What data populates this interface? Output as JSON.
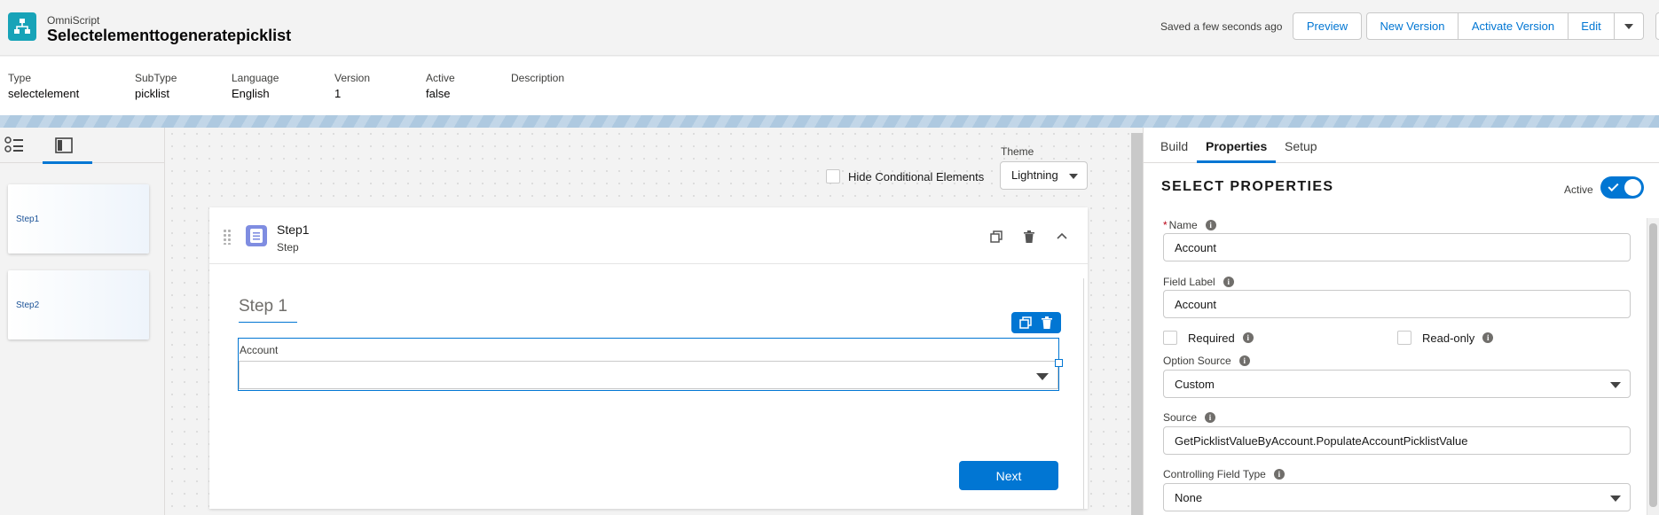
{
  "header": {
    "app_type": "OmniScript",
    "title": "Selectelementtogeneratepicklist",
    "saved_status": "Saved a few seconds ago",
    "buttons": {
      "preview": "Preview",
      "new_version": "New Version",
      "activate_version": "Activate Version",
      "edit": "Edit"
    }
  },
  "meta": [
    {
      "label": "Type",
      "value": "selectelement"
    },
    {
      "label": "SubType",
      "value": "picklist"
    },
    {
      "label": "Language",
      "value": "English"
    },
    {
      "label": "Version",
      "value": "1"
    },
    {
      "label": "Active",
      "value": "false"
    },
    {
      "label": "Description",
      "value": ""
    }
  ],
  "left_panel": {
    "steps": [
      "Step1",
      "Step2"
    ]
  },
  "canvas": {
    "hide_conditional_label": "Hide Conditional Elements",
    "theme_label": "Theme",
    "theme_value": "Lightning",
    "step": {
      "name": "Step1",
      "type": "Step",
      "title": "Step 1",
      "select_label": "Account",
      "next_label": "Next"
    }
  },
  "properties": {
    "tabs": [
      "Build",
      "Properties",
      "Setup"
    ],
    "active_tab": "Properties",
    "heading": "SELECT PROPERTIES",
    "active_label": "Active",
    "active": true,
    "name_label": "Name",
    "name_value": "Account",
    "field_label_label": "Field Label",
    "field_label_value": "Account",
    "required_label": "Required",
    "readonly_label": "Read-only",
    "option_source_label": "Option Source",
    "option_source_value": "Custom",
    "source_label": "Source",
    "source_value": "GetPicklistValueByAccount.PopulateAccountPicklistValue",
    "controlling_field_label": "Controlling Field Type",
    "controlling_field_value": "None"
  },
  "colors": {
    "brand": "#0176d3",
    "app_icon": "#17a3b8",
    "step_icon": "#7f8de1"
  },
  "icons": [
    "hierarchy-icon",
    "list-view-icon",
    "panel-view-icon",
    "drag-handle-icon",
    "step-document-icon",
    "clone-icon",
    "delete-icon",
    "collapse-icon",
    "info-icon",
    "chevron-down-icon"
  ]
}
